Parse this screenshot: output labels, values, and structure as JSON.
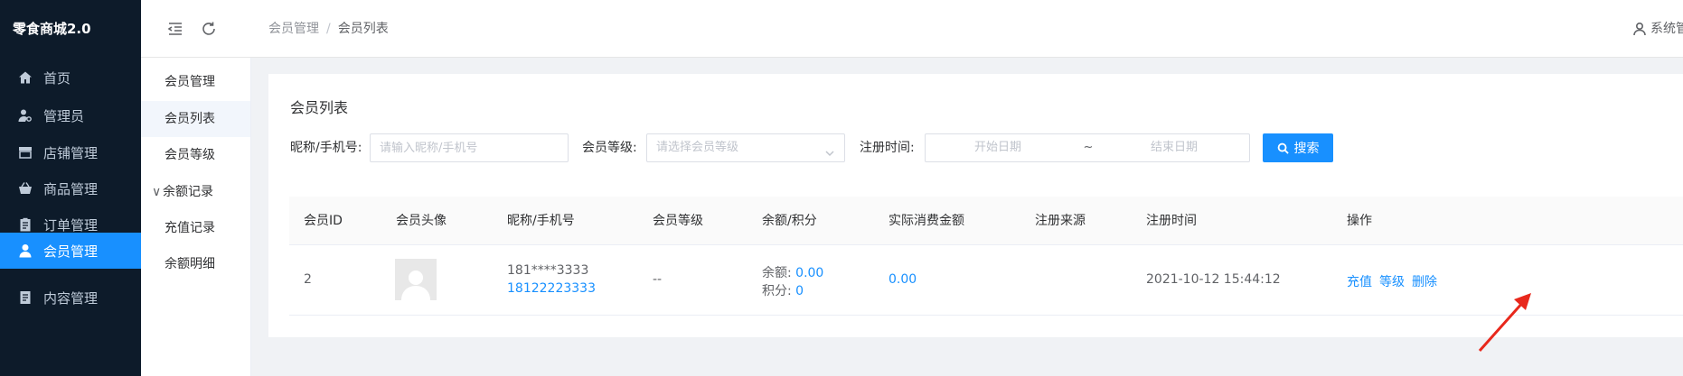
{
  "brand": {
    "title": "零食商城2.0"
  },
  "sidebar": {
    "items": [
      {
        "label": "首页",
        "icon": "home-icon"
      },
      {
        "label": "管理员",
        "icon": "admin-user-icon"
      },
      {
        "label": "店铺管理",
        "icon": "store-icon"
      },
      {
        "label": "商品管理",
        "icon": "basket-icon"
      },
      {
        "label": "订单管理",
        "icon": "clipboard-icon"
      },
      {
        "label": "会员管理",
        "icon": "member-icon",
        "active": true
      },
      {
        "label": "内容管理",
        "icon": "document-icon"
      }
    ]
  },
  "header": {
    "breadcrumb": {
      "parent": "会员管理",
      "separator": "/",
      "current": "会员列表"
    },
    "user": {
      "label": "系统管"
    }
  },
  "subnav": {
    "items": [
      {
        "label": "会员管理"
      },
      {
        "label": "会员列表",
        "active": true
      },
      {
        "label": "会员等级"
      },
      {
        "label": "余额记录",
        "expandable": true,
        "chevron": "∨"
      },
      {
        "label": "充值记录"
      },
      {
        "label": "余额明细"
      }
    ]
  },
  "card": {
    "title": "会员列表",
    "filters": {
      "nickname_label": "昵称/手机号:",
      "nickname_placeholder": "请输入昵称/手机号",
      "level_label": "会员等级:",
      "level_placeholder": "请选择会员等级",
      "regtime_label": "注册时间:",
      "start_placeholder": "开始日期",
      "range_sep": "~",
      "end_placeholder": "结束日期",
      "search_label": "搜索"
    },
    "table": {
      "headers": [
        "会员ID",
        "会员头像",
        "昵称/手机号",
        "会员等级",
        "余额/积分",
        "实际消费金额",
        "注册来源",
        "注册时间",
        "操作"
      ],
      "rows": [
        {
          "id": "2",
          "nickname": "181****3333",
          "phone": "18122223333",
          "level": "--",
          "balance_label": "余额:",
          "balance": "0.00",
          "points_label": "积分:",
          "points": "0",
          "spent": "0.00",
          "source": "",
          "reg_time": "2021-10-12 15:44:12",
          "actions": [
            "充值",
            "等级",
            "删除"
          ]
        }
      ]
    }
  },
  "colors": {
    "sidebar_bg": "#0d1b2a",
    "accent": "#1890ff",
    "annotation": "#e8281c"
  }
}
